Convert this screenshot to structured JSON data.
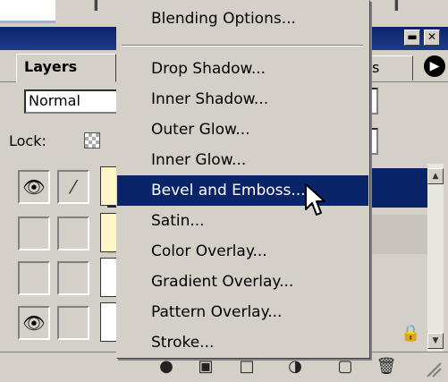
{
  "top_strip": {
    "glyph_left": "I",
    "glyph_right": "I"
  },
  "palette": {
    "window_buttons": {
      "minimize": "▬",
      "close": "✕"
    },
    "tabs": [
      {
        "label": "Layers"
      },
      {
        "label": "s"
      }
    ],
    "palette_menu_glyph": "▶",
    "blend_mode": "Normal",
    "lock_label": "Lock:"
  },
  "layers": [
    {
      "visible": true,
      "brush": true,
      "selected": true
    },
    {
      "visible": false,
      "brush": false,
      "selected": false
    },
    {
      "visible": false,
      "brush": false,
      "selected": false
    },
    {
      "visible": true,
      "brush": false,
      "selected": false,
      "locked": true
    }
  ],
  "context_menu": {
    "items": [
      {
        "label": "Blending Options..."
      },
      {
        "label": "Drop Shadow..."
      },
      {
        "label": "Inner Shadow..."
      },
      {
        "label": "Outer Glow..."
      },
      {
        "label": "Inner Glow..."
      },
      {
        "label": "Bevel and Emboss...",
        "selected": true
      },
      {
        "label": "Satin..."
      },
      {
        "label": "Color Overlay..."
      },
      {
        "label": "Gradient Overlay..."
      },
      {
        "label": "Pattern Overlay..."
      },
      {
        "label": "Stroke..."
      }
    ]
  },
  "icons": {
    "eye": "eye-icon",
    "brush": "brush-icon",
    "lock": "lock-icon",
    "cursor": "arrow-cursor-icon"
  },
  "colors": {
    "menu_highlight": "#0a246a",
    "title_bar": "#0a246a",
    "face": "#d4d0c8"
  }
}
